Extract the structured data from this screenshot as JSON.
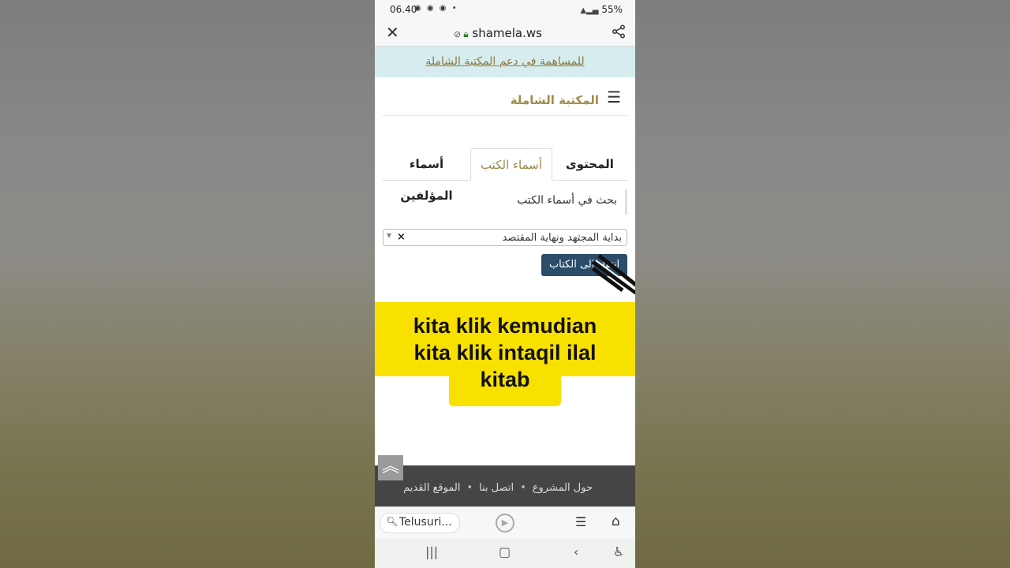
{
  "status_bar": {
    "time": "06.40",
    "battery": "55%"
  },
  "browser": {
    "domain": "shamela.ws",
    "bottom_search": "Telusuri..."
  },
  "banner": {
    "link": "للمساهمة في دعم المكتبة الشاملة"
  },
  "site": {
    "title": "المكتبة الشاملة"
  },
  "tabs": [
    {
      "label": "المحتوى"
    },
    {
      "label": "أسماء الكتب"
    },
    {
      "label": "أسماء المؤلفين"
    }
  ],
  "search": {
    "label": "بحث في أسماء الكتب",
    "selected": "بداية المجتهد ونهاية المقتصد",
    "clear": "×",
    "button": "انتقل إلى الكتاب"
  },
  "caption": {
    "line1": "kita klik kemudian",
    "line2": "kita klik intaqil ilal",
    "line3": "kitab"
  },
  "footer": {
    "about": "حول المشروع",
    "contact": "اتصل بنا",
    "old_site": "الموقع القديم",
    "dot": "•"
  }
}
